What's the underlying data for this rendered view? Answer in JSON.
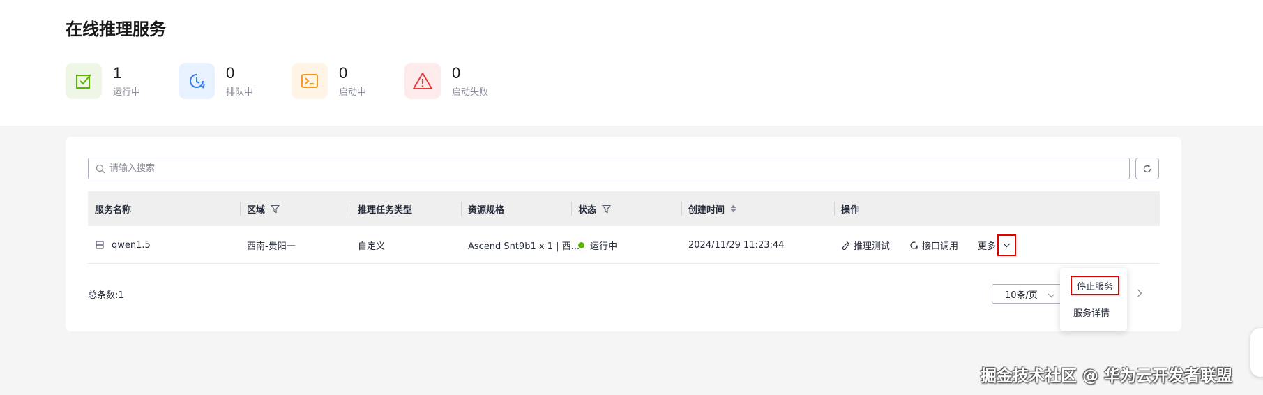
{
  "page": {
    "title": "在线推理服务"
  },
  "stats": [
    {
      "count": "1",
      "label": "运行中",
      "icon": "check-square-icon",
      "bg": "#eef7e6",
      "color": "#5cb300"
    },
    {
      "count": "0",
      "label": "排队中",
      "icon": "clock-icon",
      "bg": "#e8f1ff",
      "color": "#2f7ef5"
    },
    {
      "count": "0",
      "label": "启动中",
      "icon": "terminal-icon",
      "bg": "#fff4e6",
      "color": "#fa9a1e"
    },
    {
      "count": "0",
      "label": "启动失败",
      "icon": "warning-icon",
      "bg": "#fdeaea",
      "color": "#e43d3d"
    }
  ],
  "search": {
    "placeholder": "请输入搜索"
  },
  "table": {
    "columns": [
      "服务名称",
      "区域",
      "推理任务类型",
      "资源规格",
      "状态",
      "创建时间",
      "操作"
    ],
    "rows": [
      {
        "name": "qwen1.5",
        "region": "西南-贵阳一",
        "task_type": "自定义",
        "spec": "Ascend Snt9b1 x 1 | 西...",
        "status": "运行中",
        "created": "2024/11/29 11:23:44",
        "actions": [
          "推理测试",
          "接口调用",
          "更多"
        ]
      }
    ]
  },
  "pagination": {
    "total": "总条数:1",
    "page_size": "10条/页"
  },
  "dropdown": {
    "items": [
      "停止服务",
      "服务详情"
    ]
  },
  "watermark": "掘金技术社区 @ 华为云开发者联盟",
  "colors": {
    "accent_red_outline": "#e00000",
    "status_running": "#5cb300"
  }
}
